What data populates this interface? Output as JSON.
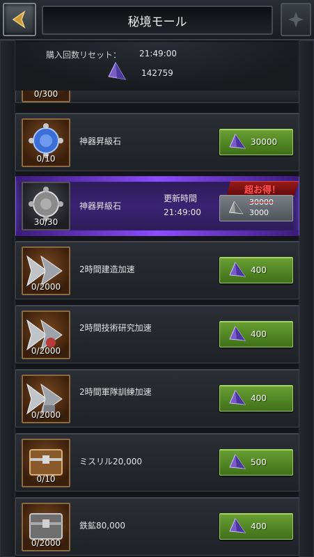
{
  "header": {
    "title": "秘境モール"
  },
  "reset": {
    "label": "購入回数リセット：",
    "time": "21:49:00",
    "gem_count": "142759"
  },
  "items": [
    {
      "count": "0/300",
      "name": "",
      "price": ""
    },
    {
      "count": "0/10",
      "name": "神器昇級石",
      "price": "30000",
      "icon": "blue-orb-icon"
    },
    {
      "count": "30/30",
      "name": "神器昇級石",
      "update_label": "更新時間",
      "update_time": "21:49:00",
      "deal": "超お得！",
      "old_price": "30000",
      "new_price": "3000",
      "icon": "silver-orb-icon"
    },
    {
      "count": "0/2000",
      "name": "2時間建造加速",
      "price": "400",
      "icon": "speedup-icon"
    },
    {
      "count": "0/2000",
      "name": "2時間技術研究加速",
      "price": "400",
      "icon": "speedup-research-icon"
    },
    {
      "count": "0/2000",
      "name": "2時間軍隊訓練加速",
      "price": "400",
      "icon": "speedup-train-icon"
    },
    {
      "count": "0/10",
      "name": "ミスリル20,000",
      "price": "500",
      "icon": "mithril-chest-icon"
    },
    {
      "count": "0/2000",
      "name": "鉄鉱80,000",
      "price": "400",
      "icon": "iron-chest-icon"
    }
  ],
  "colors": {
    "buy_button": "#4f8a22",
    "special_bg": "#3a2373",
    "deal_text": "#ff5050"
  }
}
